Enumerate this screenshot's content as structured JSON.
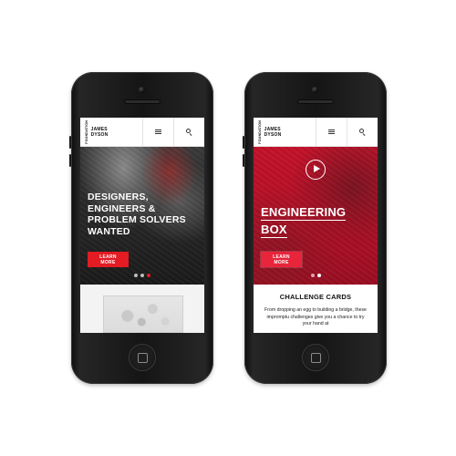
{
  "phones": [
    {
      "header": {
        "logo_vertical": "FOUNDATION",
        "logo_line1": "JAMES",
        "logo_line2": "DYSON"
      },
      "hero": {
        "headline": [
          "DESIGNERS,",
          "ENGINEERS &",
          "PROBLEM SOLVERS",
          "WANTED"
        ],
        "cta_label": "LEARN MORE",
        "slides": 3,
        "active_slide": 3
      }
    },
    {
      "header": {
        "logo_vertical": "FOUNDATION",
        "logo_line1": "JAMES",
        "logo_line2": "DYSON"
      },
      "hero": {
        "headline": [
          "ENGINEERING",
          "BOX"
        ],
        "cta_label": "LEARN MORE",
        "slides": 2,
        "active_slide": 2
      },
      "section": {
        "title": "CHALLENGE CARDS",
        "body": "From dropping an egg to building a bridge, these impromptu challenges give you a chance to try your hand at"
      }
    }
  ],
  "colors": {
    "brand_red": "#e31b23",
    "hero_red": "#c4122a"
  }
}
